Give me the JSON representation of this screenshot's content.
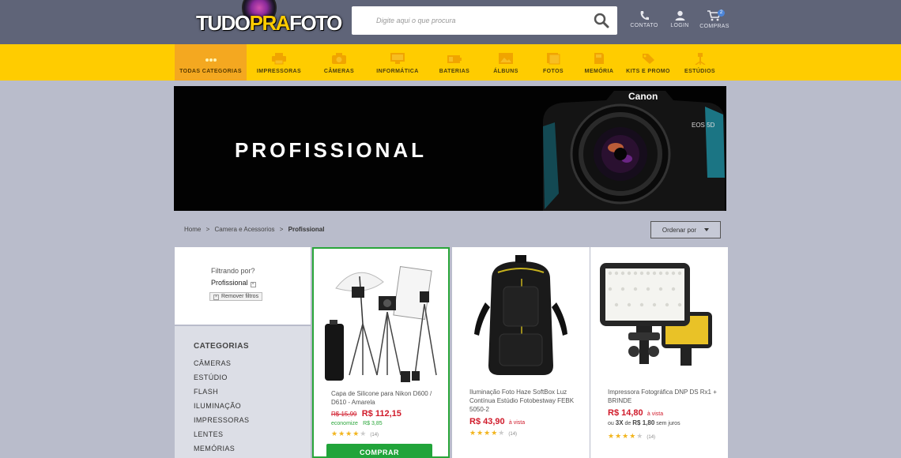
{
  "header": {
    "logo": {
      "part1": "TUDO",
      "part2": "PRA",
      "part3": "FOTO"
    },
    "search": {
      "placeholder": "Digite aqui o que procura",
      "icon": "search-icon"
    },
    "links": [
      {
        "label": "CONTATO",
        "icon": "phone-icon"
      },
      {
        "label": "LOGIN",
        "icon": "user-icon"
      },
      {
        "label": "COMPRAS",
        "icon": "cart-icon",
        "badge": "2"
      }
    ]
  },
  "nav": {
    "items": [
      {
        "label": "TODAS CATEGORIAS",
        "icon": "dots-icon",
        "active": true
      },
      {
        "label": "IMPRESSORAS",
        "icon": "printer-icon"
      },
      {
        "label": "CÂMERAS",
        "icon": "camera-icon"
      },
      {
        "label": "INFORMÁTICA",
        "icon": "monitor-icon"
      },
      {
        "label": "BATERIAS",
        "icon": "battery-icon"
      },
      {
        "label": "ÁLBUNS",
        "icon": "album-icon"
      },
      {
        "label": "FOTOS",
        "icon": "photos-icon"
      },
      {
        "label": "MEMÓRIA",
        "icon": "memory-card-icon"
      },
      {
        "label": "KITS E PROMO",
        "icon": "tag-icon"
      },
      {
        "label": "ESTÚDIOS",
        "icon": "studio-light-icon"
      }
    ],
    "colors": {
      "bar": "#ffcc00",
      "active": "#f4a820"
    }
  },
  "banner": {
    "title": "PROFISSIONAL",
    "camera_brand": "Canon",
    "camera_model": "EOS 5D"
  },
  "breadcrumb": {
    "home": "Home",
    "sep": ">",
    "parent": "Camera e Acessorios",
    "current": "Profissional"
  },
  "sort": {
    "label": "Ordenar por"
  },
  "filter": {
    "title": "Filtrando por?",
    "active_filter": "Profissional",
    "remove_label": "Remover filtros"
  },
  "categories": {
    "title": "CATEGORIAS",
    "items": [
      "CÂMERAS",
      "ESTÚDIO",
      "FLASH",
      "ILUMINAÇÃO",
      "IMPRESSORAS",
      "LENTES",
      "MEMÓRIAS"
    ]
  },
  "products": [
    {
      "name": "Capa de Silicone para Nikon D600 / D610 - Amarela",
      "old_price": "R$ 15,99",
      "price": "R$ 112,15",
      "economy_label": "economize",
      "economy_value": "R$ 3,85",
      "rating": 4,
      "reviews": "(14)",
      "buy_label": "COMPRAR",
      "selected": true
    },
    {
      "name": "Iluminação Foto Haze SoftBox Luz Contínua Estúdio Fotobestway FEBK 5050-2",
      "price": "R$ 43,90",
      "price_note": "à vista",
      "rating": 4,
      "reviews": "(14)"
    },
    {
      "name": "Impressora Fotográfica DNP DS Rx1 + BRINDE",
      "price": "R$ 14,80",
      "price_note": "à vista",
      "installment_prefix": "ou",
      "installment_count": "3X",
      "installment_mid": "de",
      "installment_value": "R$ 1,80",
      "installment_suffix": "sem juros",
      "rating": 4,
      "reviews": "(14)"
    }
  ],
  "colors": {
    "page_bg": "#b9bccb",
    "header_bg": "#5f6478",
    "price": "#d01a2a",
    "buy": "#21a43a"
  }
}
